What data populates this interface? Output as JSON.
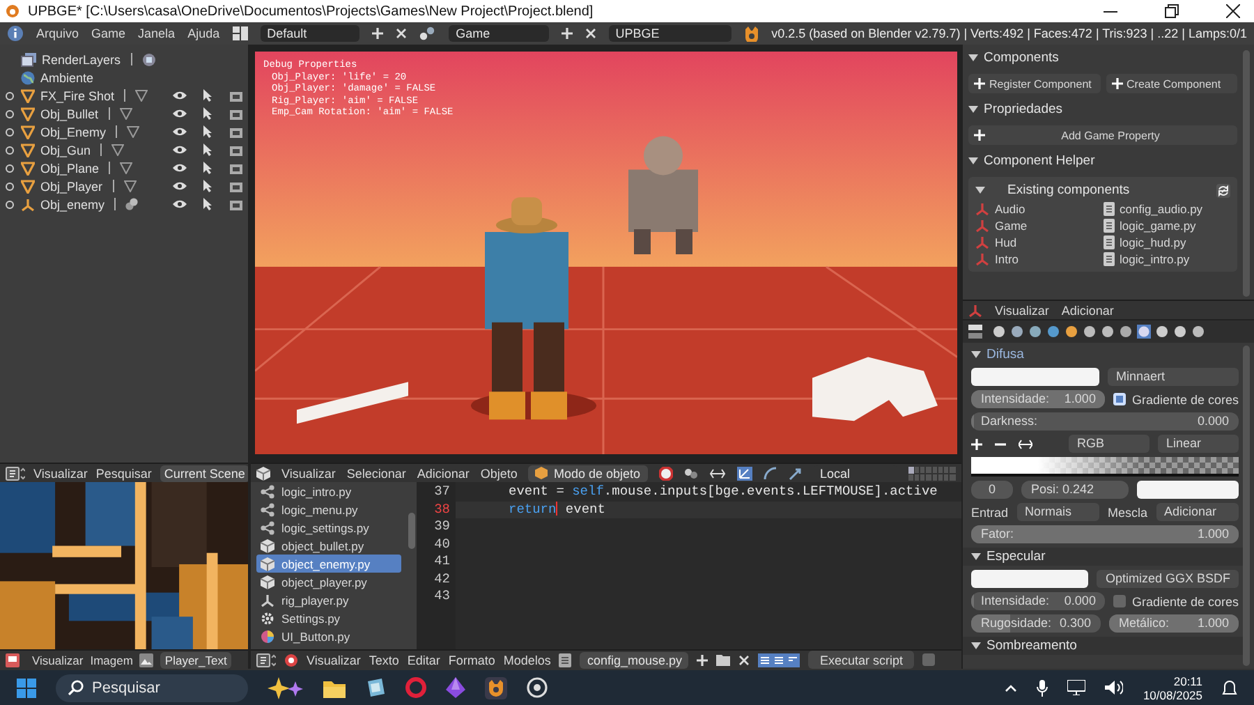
{
  "window": {
    "title": "UPBGE* [C:\\Users\\casa\\OneDrive\\Documentos\\Projects\\Games\\New Project\\Project.blend]"
  },
  "info_bar": {
    "menus": [
      "Arquivo",
      "Game",
      "Janela",
      "Ajuda"
    ],
    "layout": "Default",
    "scene": "Game",
    "engine": "UPBGE",
    "stats": "v0.2.5 (based on Blender v2.79.7) | Verts:492 | Faces:472 | Tris:923 | ..22 | Lamps:0/1"
  },
  "outliner": {
    "items": [
      {
        "label": "RenderLayers",
        "kind": "layers"
      },
      {
        "label": "Ambiente",
        "kind": "world"
      },
      {
        "label": "FX_Fire Shot",
        "kind": "mesh"
      },
      {
        "label": "Obj_Bullet",
        "kind": "mesh"
      },
      {
        "label": "Obj_Enemy",
        "kind": "mesh"
      },
      {
        "label": "Obj_Gun",
        "kind": "mesh"
      },
      {
        "label": "Obj_Plane",
        "kind": "mesh"
      },
      {
        "label": "Obj_Player",
        "kind": "mesh"
      },
      {
        "label": "Obj_enemy",
        "kind": "armature"
      }
    ],
    "header": {
      "menus": [
        "Visualizar",
        "Pesquisar"
      ],
      "display_mode": "Current Scene"
    }
  },
  "viewport": {
    "debug_title": "Debug Properties",
    "debug_lines": [
      "Obj_Player: 'life' = 20",
      "Obj_Player: 'damage' = FALSE",
      "Rig_Player: 'aim' = FALSE",
      "Emp_Cam Rotation: 'aim' = FALSE"
    ],
    "header": {
      "menus": [
        "Visualizar",
        "Selecionar",
        "Adicionar",
        "Objeto"
      ],
      "mode": "Modo de objeto",
      "orientation": "Local"
    }
  },
  "logic_editor": {
    "components_header": "Components",
    "register_button": "Register Component",
    "create_button": "Create Component",
    "properties_header": "Propriedades",
    "add_property_button": "Add Game Property",
    "helper_header": "Component Helper",
    "existing_header": "Existing components",
    "components": [
      {
        "name": "Audio",
        "file": "config_audio.py"
      },
      {
        "name": "Game",
        "file": "logic_game.py"
      },
      {
        "name": "Hud",
        "file": "logic_hud.py"
      },
      {
        "name": "Intro",
        "file": "logic_intro.py"
      }
    ],
    "header": {
      "menus": [
        "Visualizar",
        "Adicionar"
      ]
    }
  },
  "properties": {
    "diffuse_header": "Difusa",
    "diffuse_shader": "Minnaert",
    "intensity": {
      "label": "Intensidade:",
      "value": "1.000",
      "level": 1
    },
    "ramp_checked": true,
    "ramp_label": "Gradiente de cores",
    "darkness": {
      "label": "Darkness:",
      "value": "0.000",
      "level": 0
    },
    "color_mode": "RGB",
    "interpolation": "Linear",
    "ramp_index": "0",
    "ramp_position": "Posi: 0.242",
    "input_label": "Entrad",
    "input": "Normais",
    "blend_label": "Mescla",
    "blend": "Adicionar",
    "factor": {
      "label": "Fator:",
      "value": "1.000",
      "level": 1
    },
    "specular_header": "Especular",
    "specular_shader": "Optimized GGX BSDF",
    "specular_intensity": {
      "label": "Intensidade:",
      "value": "0.000",
      "level": 0
    },
    "specular_ramp_checked": false,
    "specular_ramp_label": "Gradiente de cores",
    "roughness": {
      "label": "Rugosidade:",
      "value": "0.300",
      "level": 0.3
    },
    "metallic": {
      "label": "Metálico:",
      "value": "1.000",
      "level": 1
    },
    "shading_header": "Sombreamento"
  },
  "image_editor": {
    "header": {
      "menus": [
        "Visualizar",
        "Imagem"
      ],
      "image": "Player_Text"
    }
  },
  "text_editor": {
    "files": [
      {
        "name": "logic_intro.py",
        "kind": "script",
        "selected": false
      },
      {
        "name": "logic_menu.py",
        "kind": "script",
        "selected": false
      },
      {
        "name": "logic_settings.py",
        "kind": "script",
        "selected": false
      },
      {
        "name": "object_bullet.py",
        "kind": "object",
        "selected": false
      },
      {
        "name": "object_enemy.py",
        "kind": "object",
        "selected": true
      },
      {
        "name": "object_player.py",
        "kind": "object",
        "selected": false
      },
      {
        "name": "rig_player.py",
        "kind": "armature",
        "selected": false
      },
      {
        "name": "Settings.py",
        "kind": "settings",
        "selected": false
      },
      {
        "name": "UI_Button.py",
        "kind": "ui",
        "selected": false
      }
    ],
    "lines": [
      {
        "number": "37",
        "current": false,
        "tokens": [
          {
            "text": "event = ",
            "kind": "plain"
          },
          {
            "text": "self",
            "kind": "keyword"
          },
          {
            "text": ".mouse.inputs[bge.events.LEFTMOUSE].active",
            "kind": "plain"
          }
        ]
      },
      {
        "number": "38",
        "current": true,
        "tokens": [
          {
            "text": "return",
            "kind": "keyword"
          },
          {
            "text": " event",
            "kind": "plain"
          }
        ]
      },
      {
        "number": "39",
        "current": false
      },
      {
        "number": "40",
        "current": false
      },
      {
        "number": "41",
        "current": false
      },
      {
        "number": "42",
        "current": false
      },
      {
        "number": "43",
        "current": false
      }
    ],
    "header": {
      "menus": [
        "Visualizar",
        "Texto",
        "Editar",
        "Formato",
        "Modelos"
      ],
      "text_name": "config_mouse.py",
      "run_button": "Executar script",
      "checkbox": {
        "checked": false
      }
    }
  },
  "taskbar": {
    "search_placeholder": "Pesquisar",
    "time": "20:11",
    "date": "10/08/2025"
  }
}
